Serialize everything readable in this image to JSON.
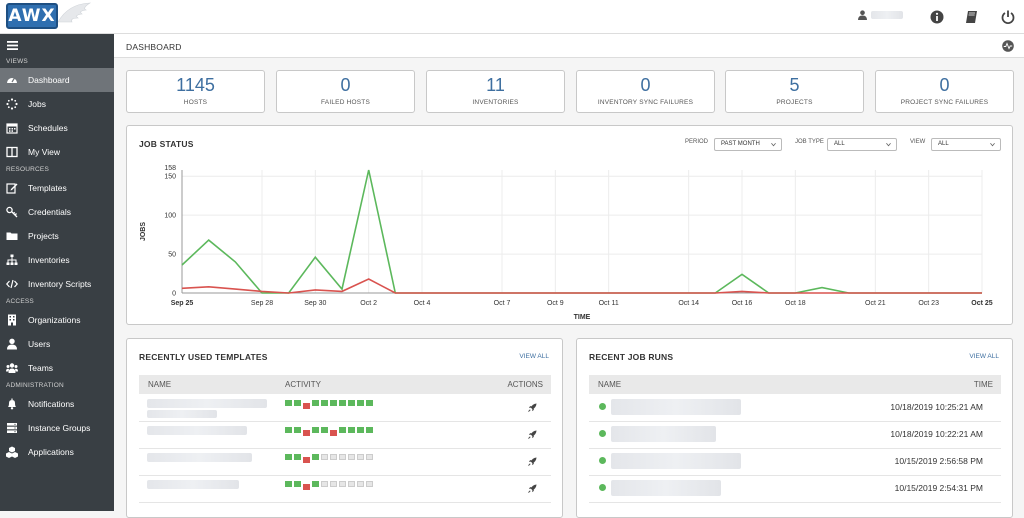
{
  "header": {
    "logo_text": "AWX"
  },
  "sidebar": {
    "sections": [
      {
        "label": "VIEWS",
        "items": [
          {
            "label": "Dashboard",
            "icon": "dashboard-icon",
            "active": true
          },
          {
            "label": "Jobs",
            "icon": "jobs-spinner-icon"
          },
          {
            "label": "Schedules",
            "icon": "calendar-icon"
          },
          {
            "label": "My View",
            "icon": "columns-icon"
          }
        ]
      },
      {
        "label": "RESOURCES",
        "items": [
          {
            "label": "Templates",
            "icon": "edit-icon"
          },
          {
            "label": "Credentials",
            "icon": "key-icon"
          },
          {
            "label": "Projects",
            "icon": "folder-icon"
          },
          {
            "label": "Inventories",
            "icon": "sitemap-icon"
          },
          {
            "label": "Inventory Scripts",
            "icon": "code-icon"
          }
        ]
      },
      {
        "label": "ACCESS",
        "items": [
          {
            "label": "Organizations",
            "icon": "building-icon"
          },
          {
            "label": "Users",
            "icon": "user-icon"
          },
          {
            "label": "Teams",
            "icon": "users-icon"
          }
        ]
      },
      {
        "label": "ADMINISTRATION",
        "items": [
          {
            "label": "Notifications",
            "icon": "bell-icon"
          },
          {
            "label": "Instance Groups",
            "icon": "server-icon"
          },
          {
            "label": "Applications",
            "icon": "cubes-icon"
          }
        ]
      }
    ]
  },
  "breadcrumb": {
    "label": "DASHBOARD"
  },
  "stats": [
    {
      "value": "1145",
      "label": "HOSTS"
    },
    {
      "value": "0",
      "label": "FAILED HOSTS"
    },
    {
      "value": "11",
      "label": "INVENTORIES"
    },
    {
      "value": "0",
      "label": "INVENTORY SYNC FAILURES"
    },
    {
      "value": "5",
      "label": "PROJECTS"
    },
    {
      "value": "0",
      "label": "PROJECT SYNC FAILURES"
    }
  ],
  "job_status": {
    "title": "JOB STATUS",
    "period_label": "PERIOD",
    "period_value": "PAST MONTH",
    "job_type_label": "JOB TYPE",
    "job_type_value": "ALL",
    "view_label": "VIEW",
    "view_value": "ALL"
  },
  "chart_data": {
    "type": "line",
    "xlabel": "TIME",
    "ylabel": "JOBS",
    "ylim": [
      0,
      158
    ],
    "y_ticks": [
      "0",
      "50",
      "100",
      "150",
      "158"
    ],
    "x_ticks": [
      "Sep 25",
      "Sep 28",
      "Sep 30",
      "Oct 2",
      "Oct 4",
      "Oct 7",
      "Oct 9",
      "Oct 11",
      "Oct 14",
      "Oct 16",
      "Oct 18",
      "Oct 21",
      "Oct 23",
      "Oct 25"
    ],
    "x": [
      "Sep 25",
      "Sep 26",
      "Sep 27",
      "Sep 28",
      "Sep 29",
      "Sep 30",
      "Oct 1",
      "Oct 2",
      "Oct 3",
      "Oct 4",
      "Oct 5",
      "Oct 6",
      "Oct 7",
      "Oct 8",
      "Oct 9",
      "Oct 10",
      "Oct 11",
      "Oct 12",
      "Oct 13",
      "Oct 14",
      "Oct 15",
      "Oct 16",
      "Oct 17",
      "Oct 18",
      "Oct 19",
      "Oct 20",
      "Oct 21",
      "Oct 22",
      "Oct 23",
      "Oct 24",
      "Oct 25"
    ],
    "series": [
      {
        "color": "#5cb85c",
        "values": [
          36,
          68,
          40,
          0,
          0,
          46,
          5,
          158,
          0,
          0,
          0,
          0,
          0,
          0,
          0,
          0,
          0,
          0,
          0,
          0,
          0,
          24,
          0,
          0,
          7,
          0,
          0,
          0,
          0,
          0,
          0
        ]
      },
      {
        "color": "#d9534f",
        "values": [
          6,
          8,
          5,
          2,
          0,
          4,
          2,
          18,
          0,
          0,
          0,
          0,
          0,
          0,
          0,
          0,
          0,
          0,
          0,
          0,
          0,
          2,
          0,
          0,
          0,
          0,
          0,
          0,
          0,
          0,
          0
        ]
      }
    ],
    "grid": true
  },
  "templates_panel": {
    "title": "RECENTLY USED TEMPLATES",
    "view_all": "VIEW ALL",
    "columns": [
      "NAME",
      "ACTIVITY",
      "ACTIONS"
    ],
    "rows": [
      {
        "activity": [
          "g",
          "g",
          "r",
          "g",
          "g",
          "g",
          "g",
          "g",
          "g",
          "g"
        ]
      },
      {
        "activity": [
          "g",
          "g",
          "r",
          "g",
          "g",
          "r",
          "g",
          "g",
          "g",
          "g"
        ]
      },
      {
        "activity": [
          "g",
          "g",
          "r",
          "g",
          "e",
          "e",
          "e",
          "e",
          "e",
          "e"
        ]
      },
      {
        "activity": [
          "g",
          "g",
          "r",
          "g",
          "e",
          "e",
          "e",
          "e",
          "e",
          "e"
        ]
      }
    ]
  },
  "jobs_panel": {
    "title": "RECENT JOB RUNS",
    "view_all": "VIEW ALL",
    "columns": [
      "NAME",
      "TIME"
    ],
    "rows": [
      {
        "time": "10/18/2019 10:25:21 AM"
      },
      {
        "time": "10/18/2019 10:22:21 AM"
      },
      {
        "time": "10/15/2019 2:56:58 PM"
      },
      {
        "time": "10/15/2019 2:54:31 PM"
      }
    ]
  }
}
